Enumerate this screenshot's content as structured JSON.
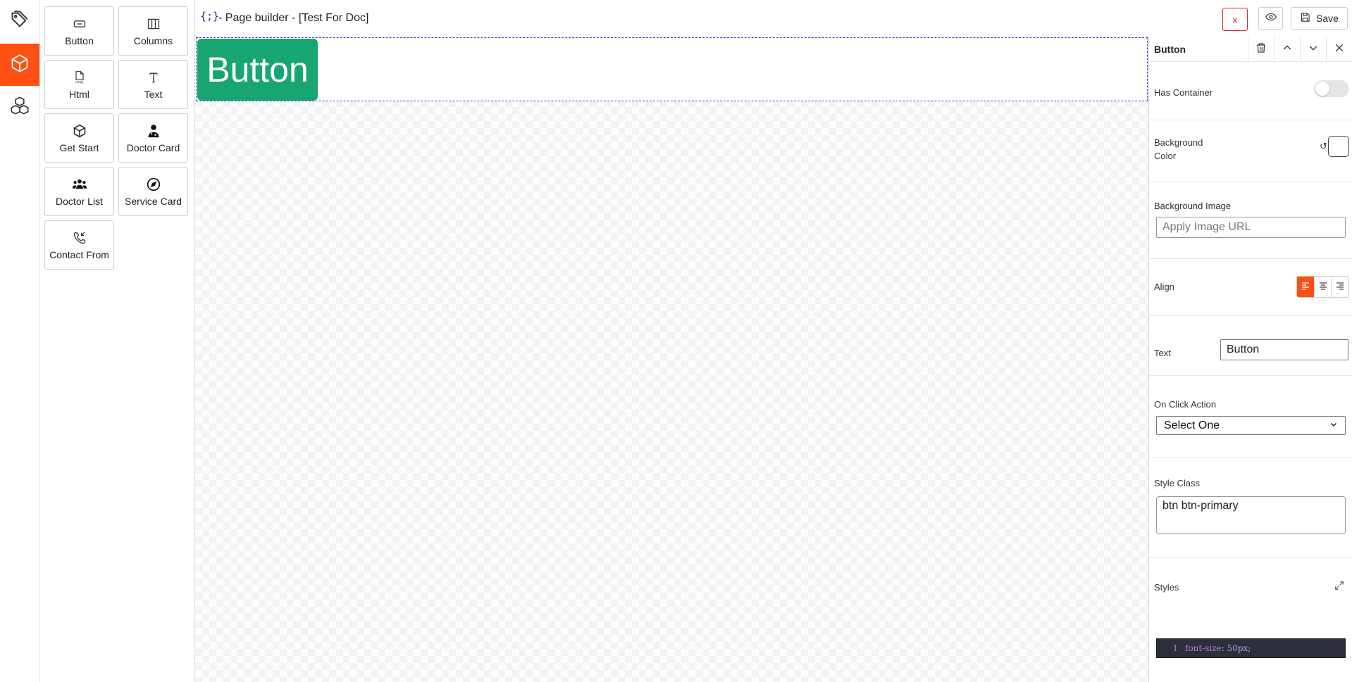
{
  "app": {
    "brand": "{;}",
    "title": "- Page builder - [Test For Doc]"
  },
  "rail": {
    "items": [
      {
        "icon": "tag-icon",
        "active": false
      },
      {
        "icon": "cube-icon",
        "active": true
      },
      {
        "icon": "cubes-icon",
        "active": false
      }
    ]
  },
  "palette": {
    "items": [
      {
        "label": "Button",
        "icon": "button-icon"
      },
      {
        "label": "Columns",
        "icon": "columns-icon"
      },
      {
        "label": "Html",
        "icon": "html-file-icon"
      },
      {
        "label": "Text",
        "icon": "text-icon"
      },
      {
        "label": "Get Start",
        "icon": "box-icon"
      },
      {
        "label": "Doctor Card",
        "icon": "doctor-icon"
      },
      {
        "label": "Doctor List",
        "icon": "users-icon"
      },
      {
        "label": "Service Card",
        "icon": "compass-icon"
      },
      {
        "label": "Contact From",
        "icon": "phone-incoming-icon"
      }
    ]
  },
  "toolbar": {
    "close_label": "x",
    "save_label": "Save"
  },
  "canvas": {
    "button_label": "Button",
    "button_color": "#17a572"
  },
  "properties": {
    "title": "Button",
    "has_container": {
      "label": "Has Container",
      "on": false
    },
    "background_color": {
      "label_line1": "Background",
      "label_line2": "Color",
      "reset_glyph": "↺",
      "value": "#ffffff"
    },
    "background_image": {
      "label": "Background Image",
      "placeholder": "Apply Image URL",
      "value": ""
    },
    "align": {
      "label": "Align",
      "selected": "left",
      "options": [
        "left",
        "center",
        "right"
      ]
    },
    "text": {
      "label": "Text",
      "value": "Button"
    },
    "on_click": {
      "label": "On Click Action",
      "selected": "Select One"
    },
    "style_class": {
      "label": "Style Class",
      "value": "btn btn-primary"
    },
    "styles": {
      "label": "Styles",
      "line_number": "1",
      "prop": "font-size",
      "colon": ": ",
      "value": "50px",
      "semicolon": ";"
    }
  },
  "colors": {
    "accent": "#ff4f12",
    "danger": "#e02424",
    "success": "#17a572"
  }
}
